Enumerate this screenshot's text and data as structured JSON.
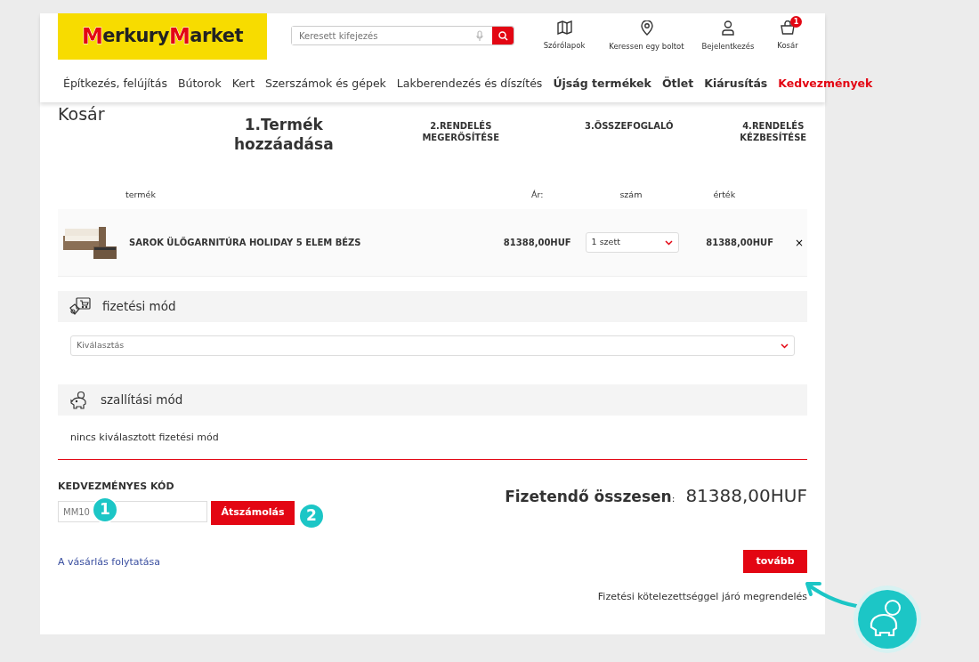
{
  "header": {
    "logo": {
      "parts": [
        {
          "kind": "mark",
          "text": "M"
        },
        {
          "kind": "word",
          "text": "erkury"
        },
        {
          "kind": "mark",
          "text": "M"
        },
        {
          "kind": "word",
          "text": "arket"
        }
      ]
    },
    "search": {
      "placeholder": "Keresett kifejezés"
    },
    "actions": [
      {
        "kind": "flyer",
        "label": "Szórólapok"
      },
      {
        "kind": "store",
        "label": "Keressen egy boltot"
      },
      {
        "kind": "user",
        "label": "Bejelentkezés"
      },
      {
        "kind": "cart",
        "label": "Kosár",
        "badge": "1"
      }
    ]
  },
  "nav": [
    {
      "label": "Építkezés, felújítás",
      "kind": "normal"
    },
    {
      "label": "Bútorok",
      "kind": "normal"
    },
    {
      "label": "Kert",
      "kind": "normal"
    },
    {
      "label": "Szerszámok és gépek",
      "kind": "normal"
    },
    {
      "label": "Lakberendezés és díszítés",
      "kind": "normal"
    },
    {
      "label": "Újság termékek",
      "kind": "bold"
    },
    {
      "label": "Ötlet",
      "kind": "bold"
    },
    {
      "label": "Kiárusítás",
      "kind": "bold"
    },
    {
      "label": "Kedvezmények",
      "kind": "promo"
    }
  ],
  "page_title": "Kosár",
  "steps": [
    {
      "label": "1.Termék hozzáadása",
      "selected": true
    },
    {
      "label": "2.RENDELÉS MEGERŐSÍTÉSE",
      "selected": false
    },
    {
      "label": "3.ÖSSZEFOGLALÓ",
      "selected": false
    },
    {
      "label": "4.RENDELÉS KÉZBESÍTÉSE",
      "selected": false
    }
  ],
  "cart_table": {
    "columns": [
      "termék",
      "Ár:",
      "szám",
      "érték"
    ],
    "rows": [
      {
        "product": "SAROK ÜLŐGARNITÚRA HOLIDAY 5 ELEM BÉZS",
        "price": "81388,00HUF",
        "quantity": "1 szett",
        "value": "81388,00HUF",
        "remove": "×"
      }
    ]
  },
  "payment": {
    "title": "fizetési mód",
    "select": "Kiválasztás"
  },
  "shipping": {
    "title": "szallítási mód",
    "message": "nincs kiválasztott fizetési mód"
  },
  "coupon": {
    "label": "KEDVEZMÉNYES KÓD",
    "value": "MM10",
    "button": "Átszámolás"
  },
  "total": {
    "label": "Fizetendő összesen",
    "colon": ":",
    "amount": "81388,00HUF"
  },
  "continue_link": "A vásárlás folytatása",
  "next_button": "tovább",
  "note": "Fizetési kötelezettséggel járó megrendelés",
  "annotations": [
    {
      "label": "1"
    },
    {
      "label": "2"
    }
  ]
}
